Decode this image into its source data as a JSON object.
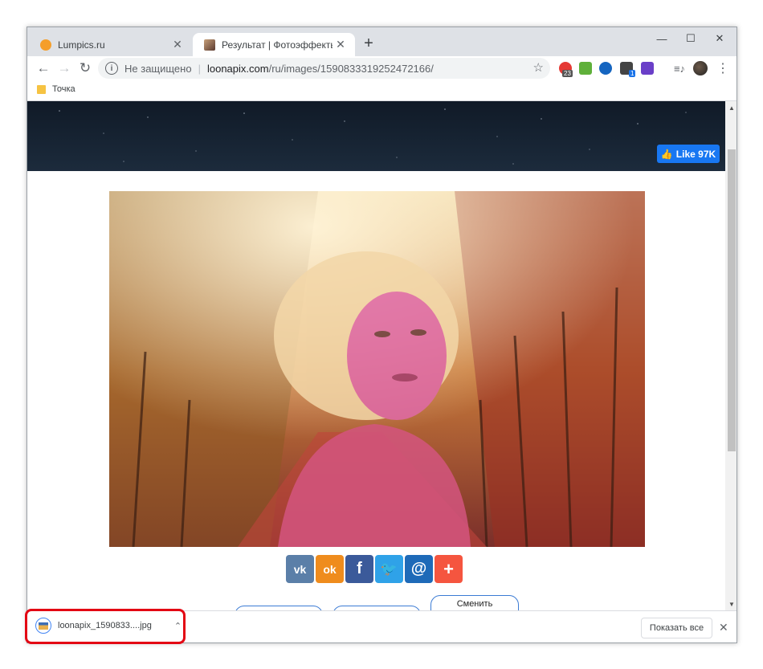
{
  "tabs": [
    {
      "title": "Lumpics.ru",
      "favicon_color": "#f59e2a"
    },
    {
      "title": "Результат | Фотоэффекты онлай",
      "favicon_color": "#7a4a3a"
    }
  ],
  "address_bar": {
    "security_text": "Не защищено",
    "url_host": "loonapix.com",
    "url_path": "/ru/images/1590833319252472166/"
  },
  "extensions": [
    {
      "name": "adblock-icon",
      "color": "#e53935",
      "badge": "23"
    },
    {
      "name": "music-icon",
      "color": "#5fb03a"
    },
    {
      "name": "globe-icon",
      "color": "#1565c0"
    },
    {
      "name": "puzzle-icon",
      "color": "#444444",
      "badge": "1"
    },
    {
      "name": "purple-ext-icon",
      "color": "#6a3fc8"
    }
  ],
  "bookmarks": [
    {
      "label": "Точка"
    }
  ],
  "page": {
    "like_label": "Like 97K",
    "share_buttons": [
      {
        "name": "vk-share-button",
        "glyph": "vk",
        "color": "#5b7fa8"
      },
      {
        "name": "odnoklassniki-share-button",
        "glyph": "ok",
        "color": "#ef8c1d"
      },
      {
        "name": "facebook-share-button",
        "glyph": "f",
        "color": "#3b5a9a"
      },
      {
        "name": "twitter-share-button",
        "glyph": "t",
        "color": "#2fa2e8"
      },
      {
        "name": "mailru-share-button",
        "glyph": "@",
        "color": "#1e6ab8"
      },
      {
        "name": "more-share-button",
        "glyph": "+",
        "color": "#f5553f"
      }
    ],
    "bottom_buttons": [
      "",
      "",
      "Сменить"
    ]
  },
  "download_bar": {
    "filename": "loonapix_1590833....jpg",
    "show_all_label": "Показать все"
  },
  "colors": {
    "highlight": "#e30613",
    "accent": "#1877f2"
  }
}
